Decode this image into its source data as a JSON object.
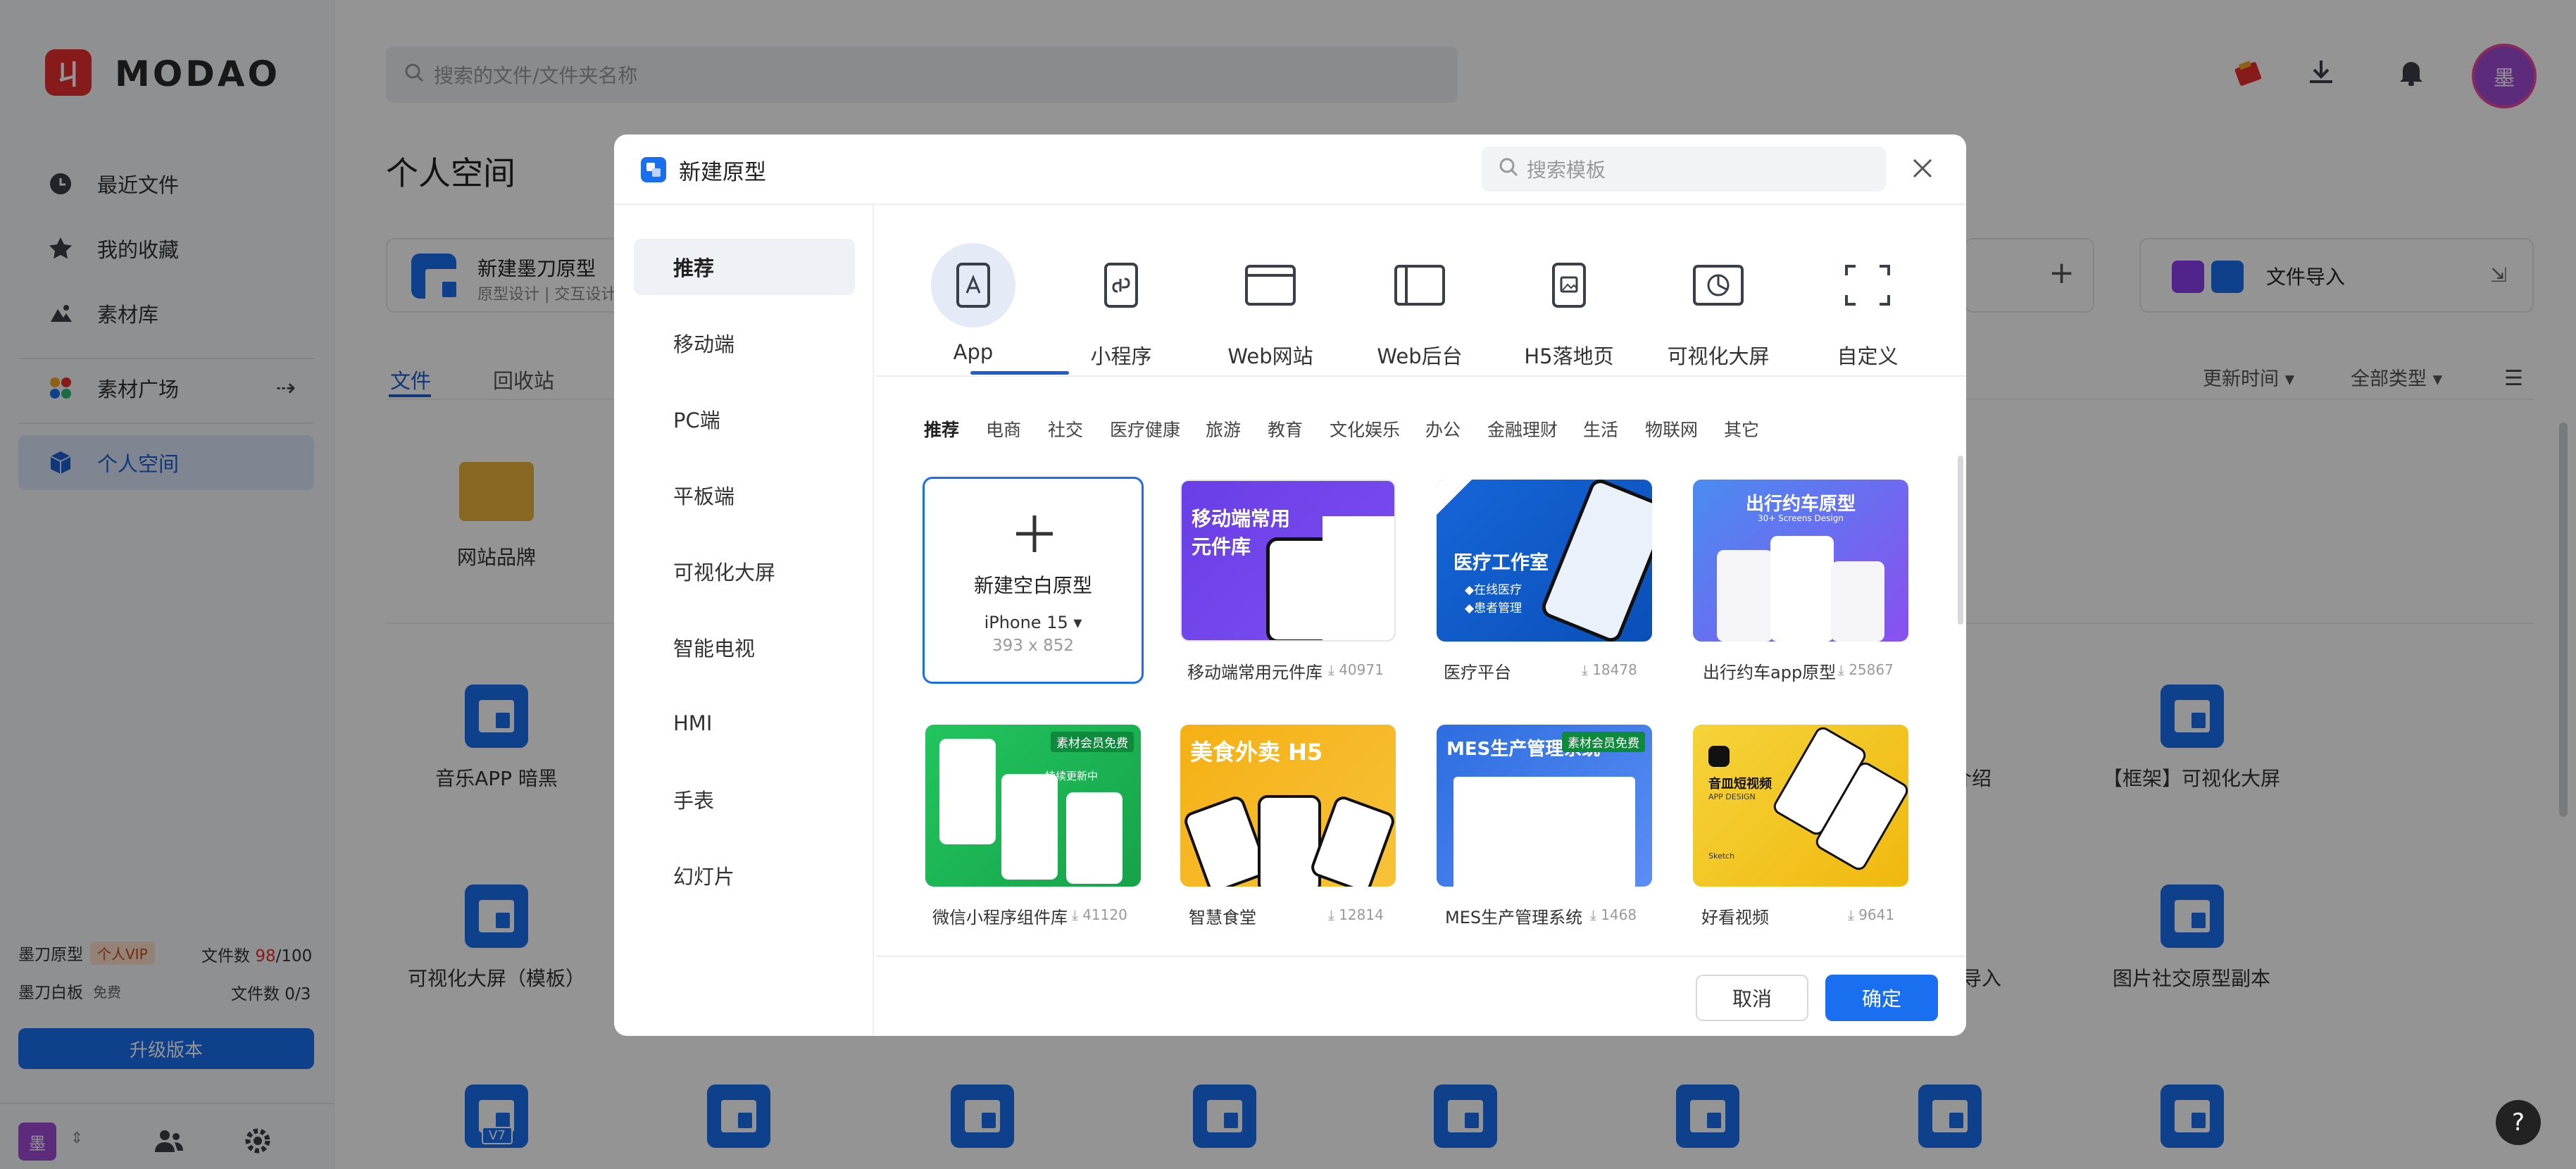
{
  "brand": {
    "logo_mark": "ㄐ",
    "name": "MODAO"
  },
  "sidebar": {
    "items": [
      {
        "label": "最近文件",
        "icon": "clock-icon"
      },
      {
        "label": "我的收藏",
        "icon": "star-icon"
      },
      {
        "label": "素材库",
        "icon": "assets-icon"
      },
      {
        "label": "素材广场",
        "icon": "grid-icon"
      },
      {
        "label": "个人空间",
        "icon": "cube-icon"
      }
    ],
    "arrow": "⇢",
    "quota": {
      "proto_label": "墨刀原型",
      "proto_badge": "个人VIP",
      "proto_files_label": "文件数",
      "proto_used": "98",
      "proto_total": "/100",
      "board_label": "墨刀白板",
      "board_badge": "免费",
      "board_files": "文件数 0/3"
    },
    "upgrade_label": "升级版本",
    "avatar_char": "墨"
  },
  "main": {
    "search_placeholder": "搜索的文件/文件夹名称",
    "title": "个人空间",
    "card_new": {
      "title": "新建墨刀原型",
      "subtitle": "原型设计 | 交互设计"
    },
    "card_import": {
      "title": "文件导入"
    },
    "tabs": [
      "文件",
      "回收站"
    ],
    "sort_label": "更新时间",
    "type_label": "全部类型",
    "folder_name": "网站品牌",
    "files": [
      "音乐APP 暗黑",
      "【框架】可视化大屏",
      "可视化大屏（模板）",
      "图片社交原型副本",
      "介绍",
      "件导入"
    ],
    "v7_badge": "V7",
    "avatar_char": "墨",
    "help": "?"
  },
  "modal": {
    "title": "新建原型",
    "search_placeholder": "搜索模板",
    "categories": [
      "推荐",
      "移动端",
      "PC端",
      "平板端",
      "可视化大屏",
      "智能电视",
      "HMI",
      "手表",
      "幻灯片"
    ],
    "types": [
      "App",
      "小程序",
      "Web网站",
      "Web后台",
      "H5落地页",
      "可视化大屏",
      "自定义"
    ],
    "subtabs": [
      "推荐",
      "电商",
      "社交",
      "医疗健康",
      "旅游",
      "教育",
      "文化娱乐",
      "办公",
      "金融理财",
      "生活",
      "物联网",
      "其它"
    ],
    "blank": {
      "title": "新建空白原型",
      "device": "iPhone 15",
      "size": "393 x 852"
    },
    "templates": [
      {
        "name": "移动端常用元件库",
        "count": "40971",
        "banner": "移动端常用元件库"
      },
      {
        "name": "医疗平台",
        "count": "18478",
        "banner": "医疗工作室",
        "bullets": [
          "◆在线医疗",
          "◆患者管理"
        ]
      },
      {
        "name": "出行约车app原型",
        "count": "25867",
        "banner": "出行约车原型",
        "sub": "30+ Screens Design"
      },
      {
        "name": "微信小程序组件库",
        "count": "41120",
        "badge": "素材会员免费",
        "caption": "持续更新中"
      },
      {
        "name": "智慧食堂",
        "count": "12814",
        "banner": "美食外卖 H5"
      },
      {
        "name": "MES生产管理系统",
        "count": "1468",
        "banner": "MES生产管理系统",
        "badge": "素材会员免费"
      },
      {
        "name": "好看视频",
        "count": "9641",
        "banner": "音皿短视频",
        "sub": "APP DESIGN",
        "tag": "Sketch"
      }
    ],
    "cancel": "取消",
    "confirm": "确定",
    "colors": {
      "accent": "#1a6ff0"
    }
  }
}
